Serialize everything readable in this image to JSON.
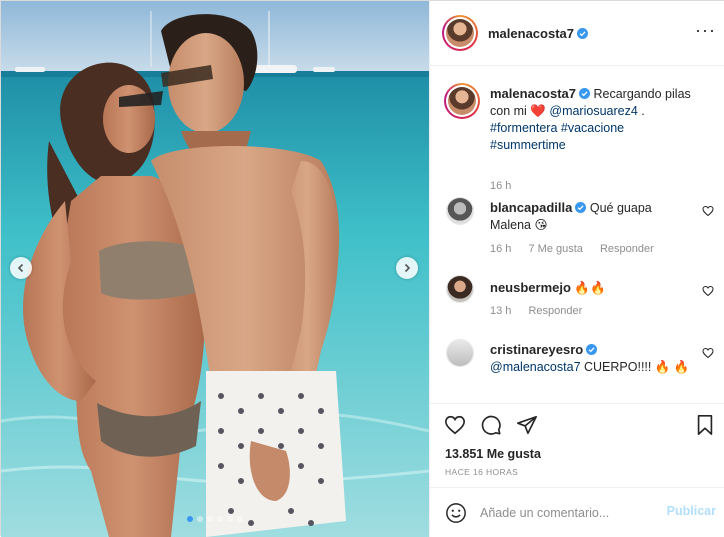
{
  "post": {
    "author": "malenacosta7",
    "carousel": {
      "total_slides": 6,
      "active_slide": 1
    }
  },
  "caption": {
    "author": "malenacosta7",
    "text_before": "Recargando pilas con mi",
    "heart_emoji": "❤️",
    "mention": "@mariosuarez4",
    "text_after": " .",
    "hashtags": [
      "#formentera",
      "#vacacione",
      "#summertime"
    ],
    "time": "16 h"
  },
  "comments": [
    {
      "author": "blancapadilla",
      "verified": true,
      "text": "Qué guapa Malena 😘",
      "time": "16 h",
      "likes": "7 Me gusta",
      "reply": "Responder"
    },
    {
      "author": "neusbermejo",
      "verified": false,
      "text": "🔥🔥",
      "time": "13 h",
      "likes": "",
      "reply": "Responder"
    },
    {
      "author": "cristinareyesro",
      "verified": true,
      "mention": "@malenacosta7",
      "text": " CUERPO!!!! 🔥 🔥"
    }
  ],
  "stats": {
    "likes_count": "13.851",
    "likes_label": "Me gusta",
    "timestamp": "Hace 16 horas"
  },
  "composer": {
    "placeholder": "Añade un comentario...",
    "post_label": "Publicar"
  },
  "icons": {
    "more": "more-options-icon",
    "like": "heart-icon",
    "comment": "comment-icon",
    "share": "paper-plane-icon",
    "save": "bookmark-icon",
    "emoji": "smiley-icon",
    "verified": "verified-badge-icon"
  },
  "colors": {
    "verified": "#3897f0",
    "link": "#00376b",
    "muted": "#8e8e8e",
    "publish_disabled": "#b2dffc"
  }
}
